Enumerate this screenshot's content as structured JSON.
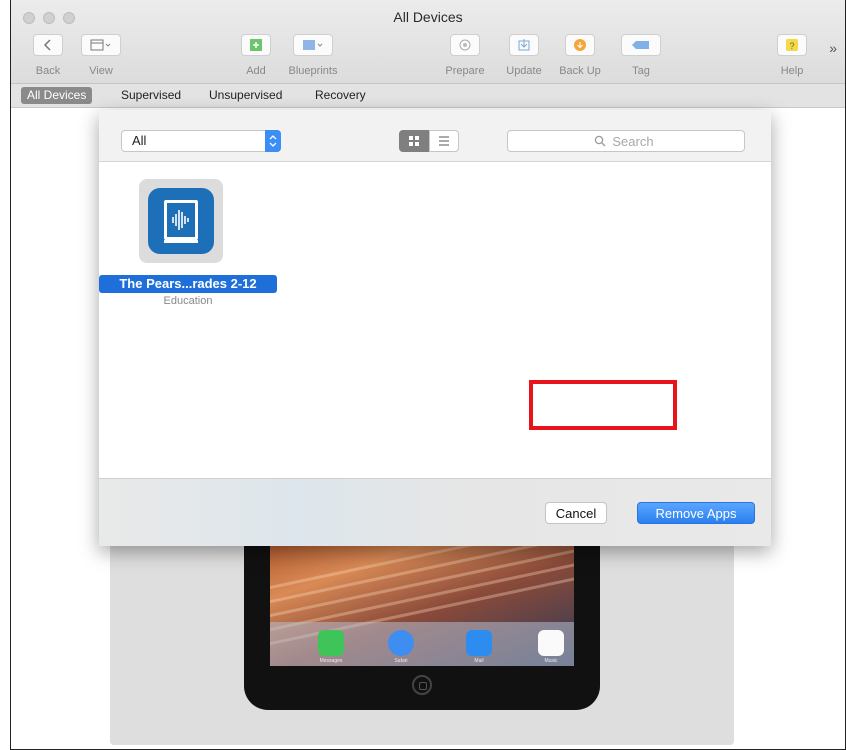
{
  "window": {
    "title": "All Devices"
  },
  "toolbar": {
    "back_label": "Back",
    "view_label": "View",
    "add_label": "Add",
    "blueprints_label": "Blueprints",
    "prepare_label": "Prepare",
    "update_label": "Update",
    "backup_label": "Back Up",
    "tag_label": "Tag",
    "help_label": "Help",
    "overflow_label": "»"
  },
  "filters": {
    "all_devices": "All Devices",
    "supervised": "Supervised",
    "unsupervised": "Unsupervised",
    "recovery": "Recovery",
    "active": "All Devices"
  },
  "dialog": {
    "category_selected": "All",
    "search_placeholder": "Search",
    "view_mode": "grid",
    "apps": [
      {
        "name": "The Pears...rades 2-12",
        "category": "Education",
        "selected": true
      }
    ],
    "cancel_label": "Cancel",
    "remove_label": "Remove Apps"
  },
  "device": {
    "dock_apps": [
      "Messages",
      "Safari",
      "Mail",
      "Music"
    ]
  },
  "colors": {
    "accent": "#2b7fef",
    "highlight_box": "#e8141b",
    "app_icon": "#1d6fb8"
  }
}
